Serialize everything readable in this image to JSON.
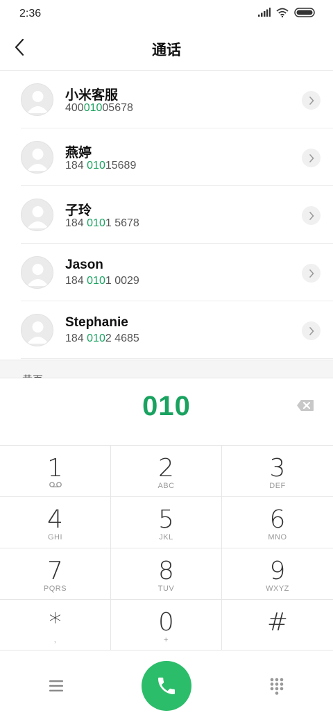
{
  "status_bar": {
    "time": "2:36",
    "icons": [
      "signal-icon",
      "wifi-icon",
      "battery-icon"
    ]
  },
  "header": {
    "title": "通话",
    "back_icon": "chevron-left-icon"
  },
  "contacts": [
    {
      "name": "小米客服",
      "number_parts": [
        "400",
        "010",
        "05678"
      ]
    },
    {
      "name": "燕婷",
      "number_parts": [
        "184 ",
        "010",
        "15689"
      ]
    },
    {
      "name": "子玲",
      "number_parts": [
        "184 ",
        "010",
        "1 5678"
      ]
    },
    {
      "name": "Jason",
      "number_parts": [
        "184 ",
        "010",
        "1 0029"
      ]
    },
    {
      "name": "Stephanie",
      "number_parts": [
        "184 ",
        "010",
        "2 4685"
      ]
    }
  ],
  "section": {
    "label": "黄页"
  },
  "dialer": {
    "dialed_number": "010",
    "backspace_icon": "backspace-icon"
  },
  "keypad": [
    {
      "digit": "1",
      "letters": "",
      "sub_icon": "voicemail-icon"
    },
    {
      "digit": "2",
      "letters": "ABC"
    },
    {
      "digit": "3",
      "letters": "DEF"
    },
    {
      "digit": "4",
      "letters": "GHI"
    },
    {
      "digit": "5",
      "letters": "JKL"
    },
    {
      "digit": "6",
      "letters": "MNO"
    },
    {
      "digit": "7",
      "letters": "PQRS"
    },
    {
      "digit": "8",
      "letters": "TUV"
    },
    {
      "digit": "9",
      "letters": "WXYZ"
    },
    {
      "digit": "*",
      "letters": ","
    },
    {
      "digit": "0",
      "letters": "+"
    },
    {
      "digit": "#",
      "letters": ""
    }
  ],
  "bottom_bar": {
    "menu_icon": "menu-icon",
    "call_icon": "phone-icon",
    "keypad_icon": "dialpad-icon"
  },
  "colors": {
    "accent": "#1aa260",
    "call_button": "#2cbd6a"
  }
}
